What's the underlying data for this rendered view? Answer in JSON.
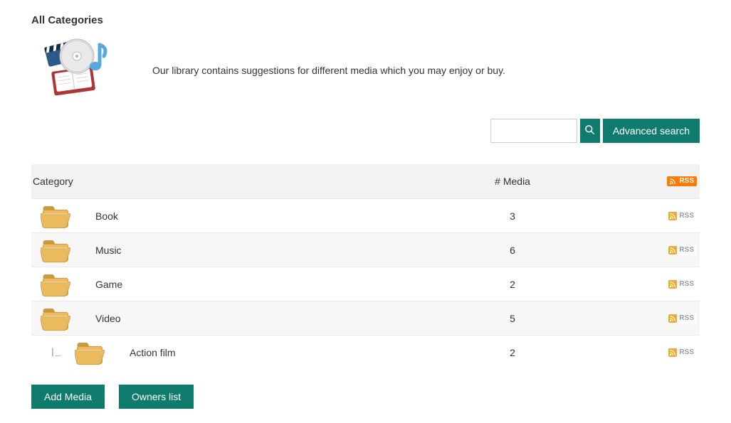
{
  "header": {
    "title": "All Categories",
    "intro": "Our library contains suggestions for different media which you may enjoy or buy."
  },
  "search": {
    "value": "",
    "placeholder": "",
    "search_icon_name": "search-icon",
    "advanced_label": "Advanced search"
  },
  "colors": {
    "accent": "#0f7b6c",
    "rss_orange": "#ff7a00",
    "folder_tan": "#e9bb5e",
    "folder_tan_dark": "#c9983f",
    "rss_row_icon": "#f3a629"
  },
  "table": {
    "headers": {
      "category": "Category",
      "media_count": "# Media",
      "rss_label": "RSS"
    },
    "rows": [
      {
        "name": "Book",
        "count": 3,
        "indent": 0,
        "rss_label": "RSS"
      },
      {
        "name": "Music",
        "count": 6,
        "indent": 0,
        "rss_label": "RSS"
      },
      {
        "name": "Game",
        "count": 2,
        "indent": 0,
        "rss_label": "RSS"
      },
      {
        "name": "Video",
        "count": 5,
        "indent": 0,
        "rss_label": "RSS"
      },
      {
        "name": "Action film",
        "count": 2,
        "indent": 1,
        "rss_label": "RSS"
      }
    ]
  },
  "actions": {
    "add_media": "Add Media",
    "owners_list": "Owners list"
  }
}
